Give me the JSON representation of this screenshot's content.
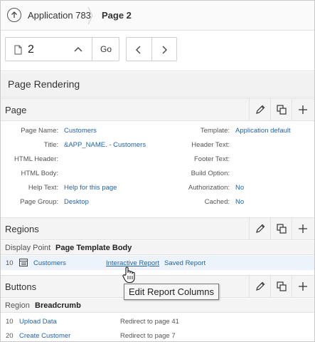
{
  "breadcrumb": {
    "app": "Application 783",
    "page": "Page 2"
  },
  "toolbar": {
    "page_number": "2",
    "go_label": "Go"
  },
  "panel_title": "Page Rendering",
  "page_section": {
    "title": "Page",
    "props_left": [
      {
        "label": "Page Name:",
        "value": "Customers"
      },
      {
        "label": "Title:",
        "value": "&APP_NAME. - Customers"
      },
      {
        "label": "HTML Header:",
        "value": ""
      },
      {
        "label": "HTML Body:",
        "value": ""
      },
      {
        "label": "Help Text:",
        "value": "Help for this page"
      },
      {
        "label": "Page Group:",
        "value": "Desktop"
      }
    ],
    "props_right": [
      {
        "label": "Template:",
        "value": "Application default"
      },
      {
        "label": "Header Text:",
        "value": ""
      },
      {
        "label": "Footer Text:",
        "value": ""
      },
      {
        "label": "Build Option:",
        "value": ""
      },
      {
        "label": "Authorization:",
        "value": "No"
      },
      {
        "label": "Cached:",
        "value": "No"
      }
    ]
  },
  "regions_section": {
    "title": "Regions",
    "display_point_label": "Display Point",
    "display_point_value": "Page Template Body",
    "row": {
      "seq": "10",
      "name": "Customers",
      "type_link": "Interactive Report",
      "type_suffix": "Saved Report"
    }
  },
  "buttons_section": {
    "title": "Buttons",
    "region_label": "Region",
    "region_value": "Breadcrumb",
    "rows": [
      {
        "seq": "10",
        "name": "Upload Data",
        "action": "Redirect to page 41"
      },
      {
        "seq": "20",
        "name": "Create Customer",
        "action": "Redirect to page 7"
      }
    ]
  },
  "tooltip": "Edit Report Columns",
  "colors": {
    "link": "#2264a6",
    "header_bg": "#f4f4f4",
    "highlight_row": "#edf3fa"
  }
}
